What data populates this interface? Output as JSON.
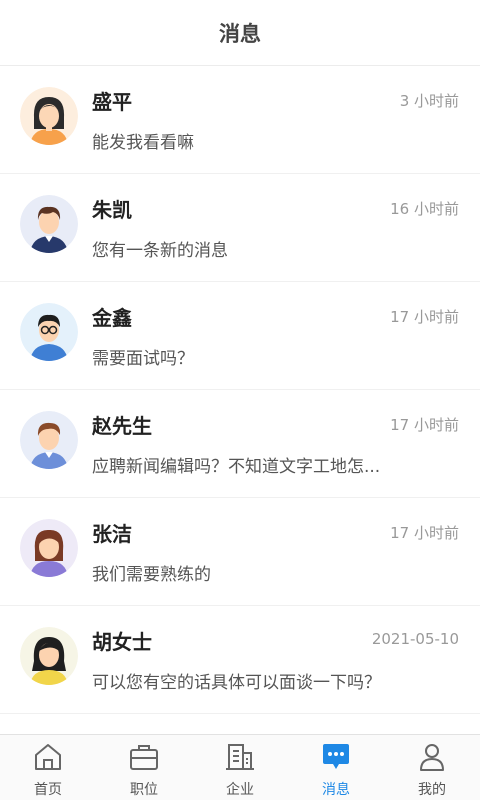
{
  "header": {
    "title": "消息"
  },
  "messages": [
    {
      "name": "盛平",
      "time": "3 小时前",
      "preview": "能发我看看嘛"
    },
    {
      "name": "朱凯",
      "time": "16 小时前",
      "preview": "您有一条新的消息"
    },
    {
      "name": "金鑫",
      "time": "17 小时前",
      "preview": "需要面试吗？"
    },
    {
      "name": "赵先生",
      "time": "17 小时前",
      "preview": "应聘新闻编辑吗？不知道文字工地怎..."
    },
    {
      "name": "张洁",
      "time": "17 小时前",
      "preview": "我们需要熟练的"
    },
    {
      "name": "胡女士",
      "time": "2021-05-10",
      "preview": "可以您有空的话具体可以面谈一下吗？"
    }
  ],
  "tabbar": {
    "tabs": [
      {
        "label": "首页",
        "icon": "home-icon"
      },
      {
        "label": "职位",
        "icon": "briefcase-icon"
      },
      {
        "label": "企业",
        "icon": "building-icon"
      },
      {
        "label": "消息",
        "icon": "chat-bubble-icon",
        "active": true
      },
      {
        "label": "我的",
        "icon": "user-icon"
      }
    ],
    "active_color": "#1e88e5"
  }
}
